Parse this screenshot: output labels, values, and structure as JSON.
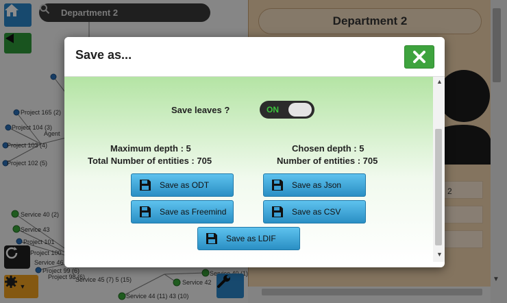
{
  "background": {
    "search": {
      "value": "Department 2",
      "icon": "search-icon"
    },
    "panel": {
      "title": "Department 2",
      "field_value": "2"
    },
    "graph_labels": [
      "Project 165 (2)",
      "Project 104 (3)",
      "Project 103 (4)",
      "Project 102 (5)",
      "Agent",
      "Service 40 (2)",
      "Service 43",
      "Project 101",
      "Project 100",
      "Service 46",
      "Project 99 (6)",
      "Project 98 (6)",
      "Service 45 (7) 5 (15)",
      "Service 44 (11) 43 (10)",
      "Service 40 (1)",
      "Service 42"
    ]
  },
  "dialog": {
    "title": "Save as...",
    "close_icon": "close-icon",
    "save_leaves": {
      "label": "Save leaves ?",
      "toggle": "ON"
    },
    "stats": {
      "max_depth": "Maximum depth : 5",
      "total_entities": "Total Number of entities : 705",
      "chosen_depth": "Chosen depth : 5",
      "num_entities": "Number of entities : 705"
    },
    "buttons": {
      "odt": "Save as ODT",
      "json": "Save as Json",
      "freemind": "Save as Freemind",
      "csv": "Save as CSV",
      "ldif": "Save as LDIF"
    }
  },
  "colors": {
    "close_button": "#3ea33e",
    "save_button": "#2a8fc4",
    "toggle_on": "#3cc43c",
    "panel": "#f0d4ae"
  }
}
